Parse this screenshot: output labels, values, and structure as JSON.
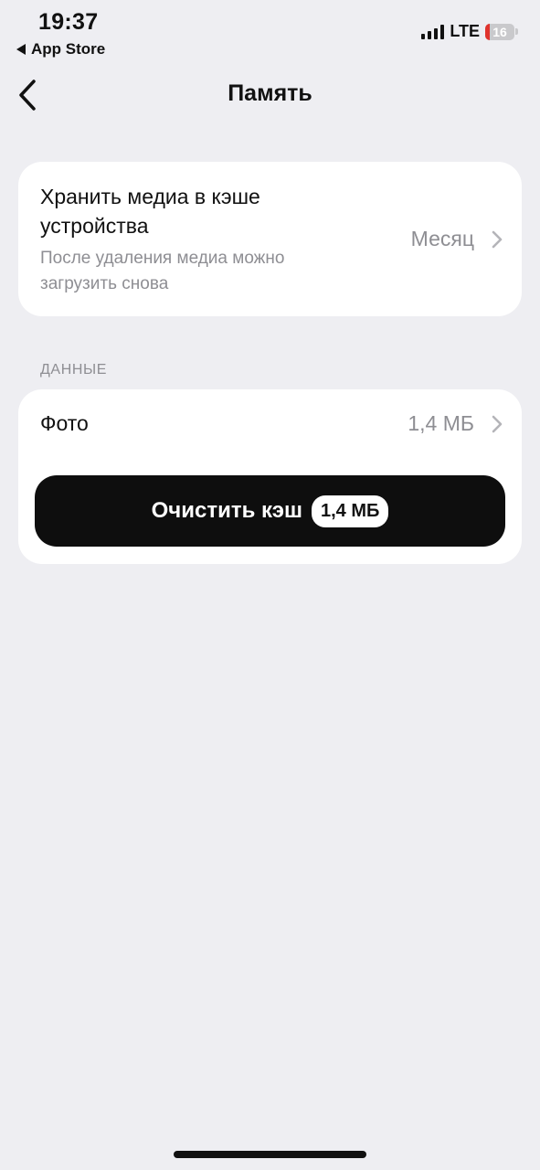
{
  "status_bar": {
    "time": "19:37",
    "back_app": "App Store",
    "network": "LTE",
    "battery": "16",
    "battery_level": 0.16
  },
  "nav": {
    "title": "Память"
  },
  "cache_setting": {
    "title": "Хранить медиа в кэше устройства",
    "subtitle": "После удаления медиа можно загрузить снова",
    "value": "Месяц"
  },
  "data_section": {
    "header": "ДАННЫЕ",
    "photo_label": "Фото",
    "photo_value": "1,4 МБ",
    "clear_label": "Очистить кэш",
    "clear_size": "1,4 МБ"
  },
  "colors": {
    "background": "#eeeef2",
    "card": "#ffffff",
    "button": "#0e0e0e",
    "secondary_text": "#8e8e93",
    "battery_low": "#e0332d"
  },
  "icons": {
    "back": "chevron-left-icon",
    "row_chevron": "chevron-right-icon",
    "signal": "signal-bars-icon",
    "battery": "battery-icon"
  }
}
